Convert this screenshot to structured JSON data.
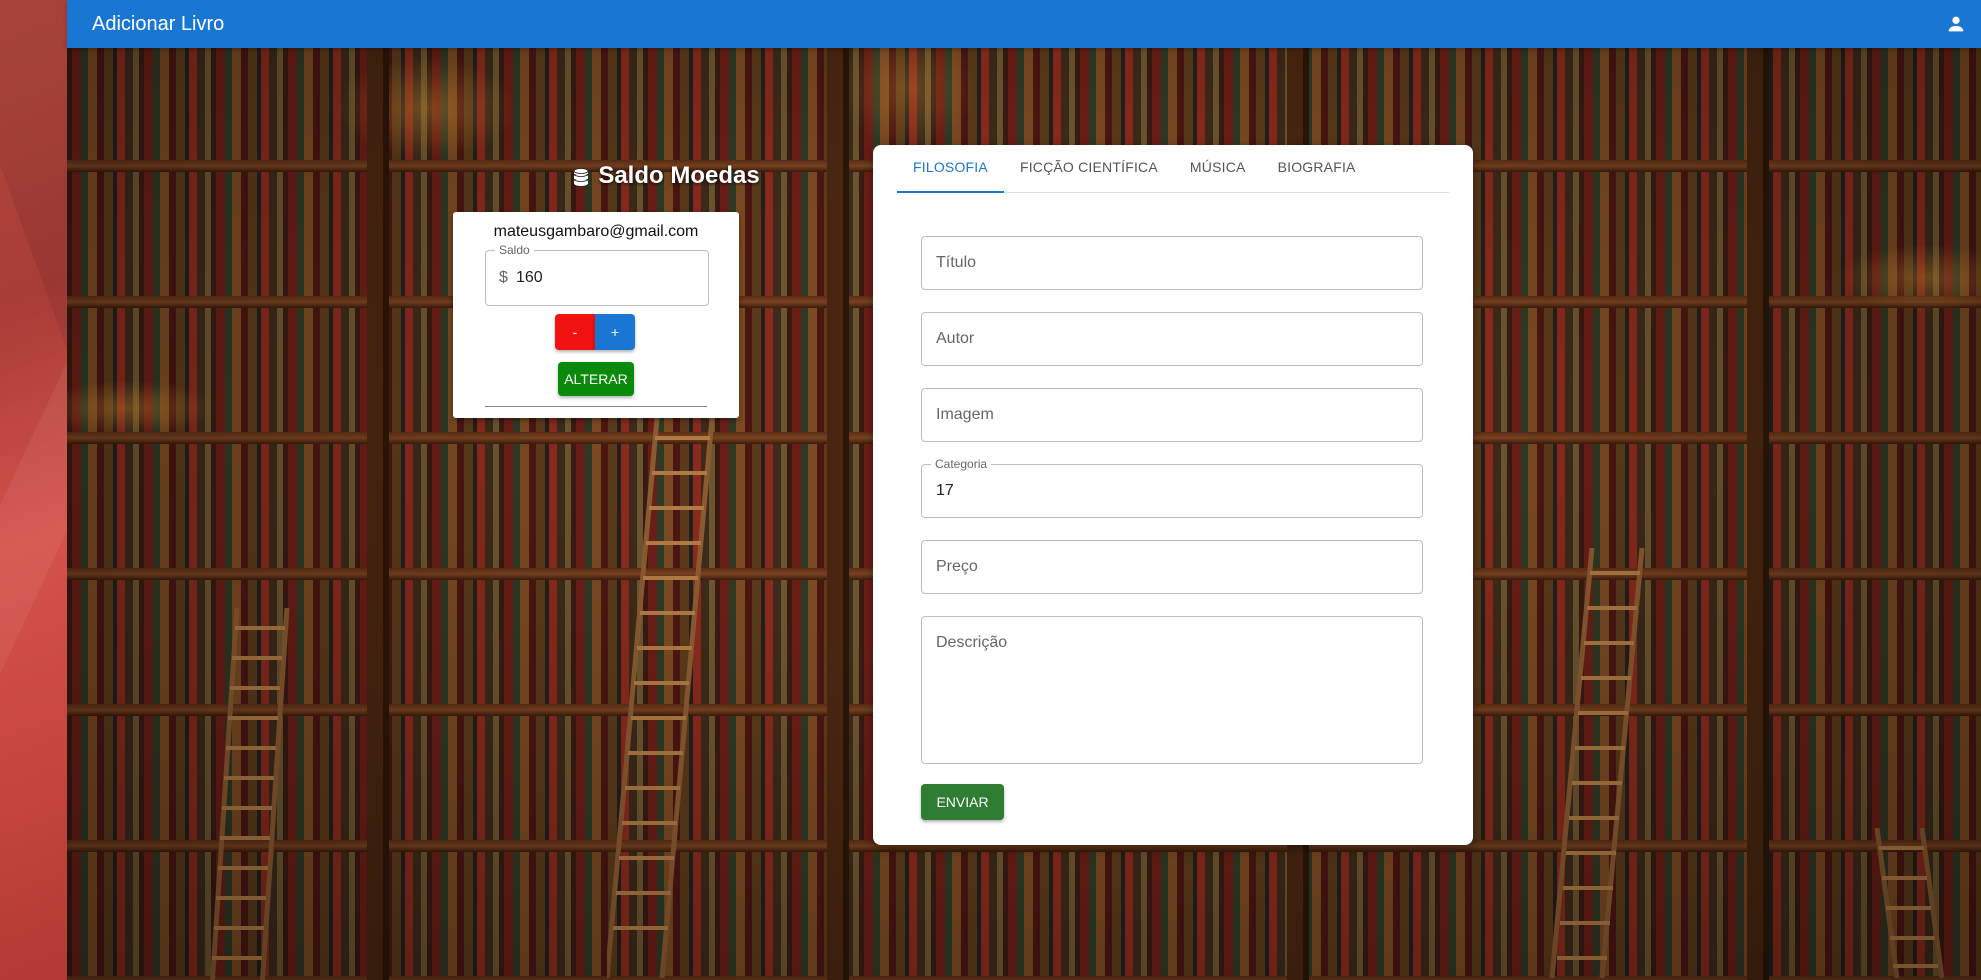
{
  "app": {
    "title": "Adicionar Livro",
    "user_icon": "person-icon"
  },
  "saldo": {
    "heading": "Saldo Moedas",
    "icon": "coins-icon",
    "email": "mateusgambaro@gmail.com",
    "field_label": "Saldo",
    "prefix": "$",
    "value": "160",
    "minus_label": "-",
    "plus_label": "+",
    "alterar_label": "ALTERAR",
    "colors": {
      "minus": "#f21212",
      "plus": "#1976d2",
      "alterar": "#0a8a0a"
    }
  },
  "form": {
    "tabs": [
      {
        "label": "FILOSOFIA",
        "active": true
      },
      {
        "label": "FICÇÃO CIENTÍFICA",
        "active": false
      },
      {
        "label": "MÚSICA",
        "active": false
      },
      {
        "label": "BIOGRAFIA",
        "active": false
      }
    ],
    "fields": {
      "titulo": {
        "placeholder": "Título"
      },
      "autor": {
        "placeholder": "Autor"
      },
      "imagem": {
        "placeholder": "Imagem"
      },
      "categoria": {
        "label": "Categoria",
        "value": "17"
      },
      "preco": {
        "placeholder": "Preço"
      },
      "descricao": {
        "placeholder": "Descrição"
      }
    },
    "submit_label": "ENVIAR"
  },
  "colors": {
    "appbar": "#1976d2",
    "tab_active": "#1976d2",
    "submit": "#2e7d32"
  }
}
